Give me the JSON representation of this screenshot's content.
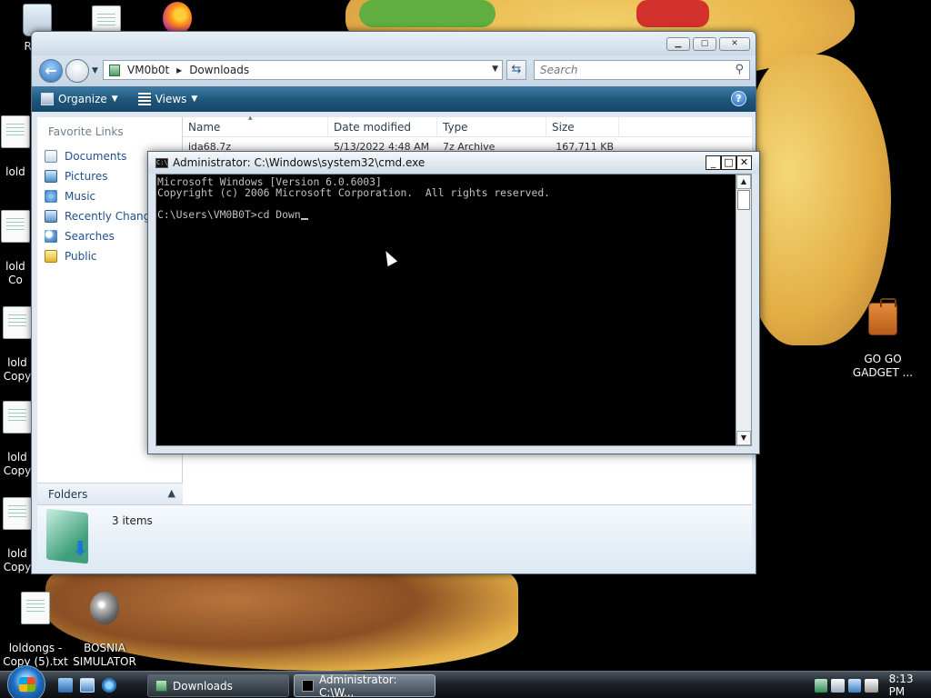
{
  "desktop": {
    "icons": [
      {
        "label": "Recy"
      },
      {
        "label": ""
      },
      {
        "label": ""
      },
      {
        "label": "lold"
      },
      {
        "label": "lold\nCo"
      },
      {
        "label": "lold\nCopy"
      },
      {
        "label": "lold\nCopy"
      },
      {
        "label": "lold\nCopy"
      },
      {
        "label": "loldongs -\nCopy (5).txt"
      },
      {
        "label": "BOSNIA\nSIMULATOR"
      },
      {
        "label": "GO GO\nGADGET ..."
      }
    ]
  },
  "explorer": {
    "breadcrumb": [
      "VM0b0t",
      "Downloads"
    ],
    "search_placeholder": "Search",
    "toolbar": {
      "organize": "Organize",
      "views": "Views"
    },
    "favorites_header": "Favorite Links",
    "favorites": [
      "Documents",
      "Pictures",
      "Music",
      "Recently Change",
      "Searches",
      "Public"
    ],
    "folders_label": "Folders",
    "columns": {
      "name": "Name",
      "date": "Date modified",
      "type": "Type",
      "size": "Size"
    },
    "files": [
      {
        "name": "ida68.7z",
        "date": "5/13/2022 4:48 AM",
        "type": "7z Archive",
        "size": "167,711 KB"
      }
    ],
    "status_count": "3 items"
  },
  "cmd": {
    "title": "Administrator: C:\\Windows\\system32\\cmd.exe",
    "icon_text": "C:\\",
    "lines": [
      "Microsoft Windows [Version 6.0.6003]",
      "Copyright (c) 2006 Microsoft Corporation.  All rights reserved.",
      "",
      "C:\\Users\\VM0B0T>cd Down"
    ]
  },
  "taskbar": {
    "buttons": [
      {
        "label": "Downloads"
      },
      {
        "label": "Administrator: C:\\W..."
      }
    ],
    "clock": "8:13 PM"
  }
}
